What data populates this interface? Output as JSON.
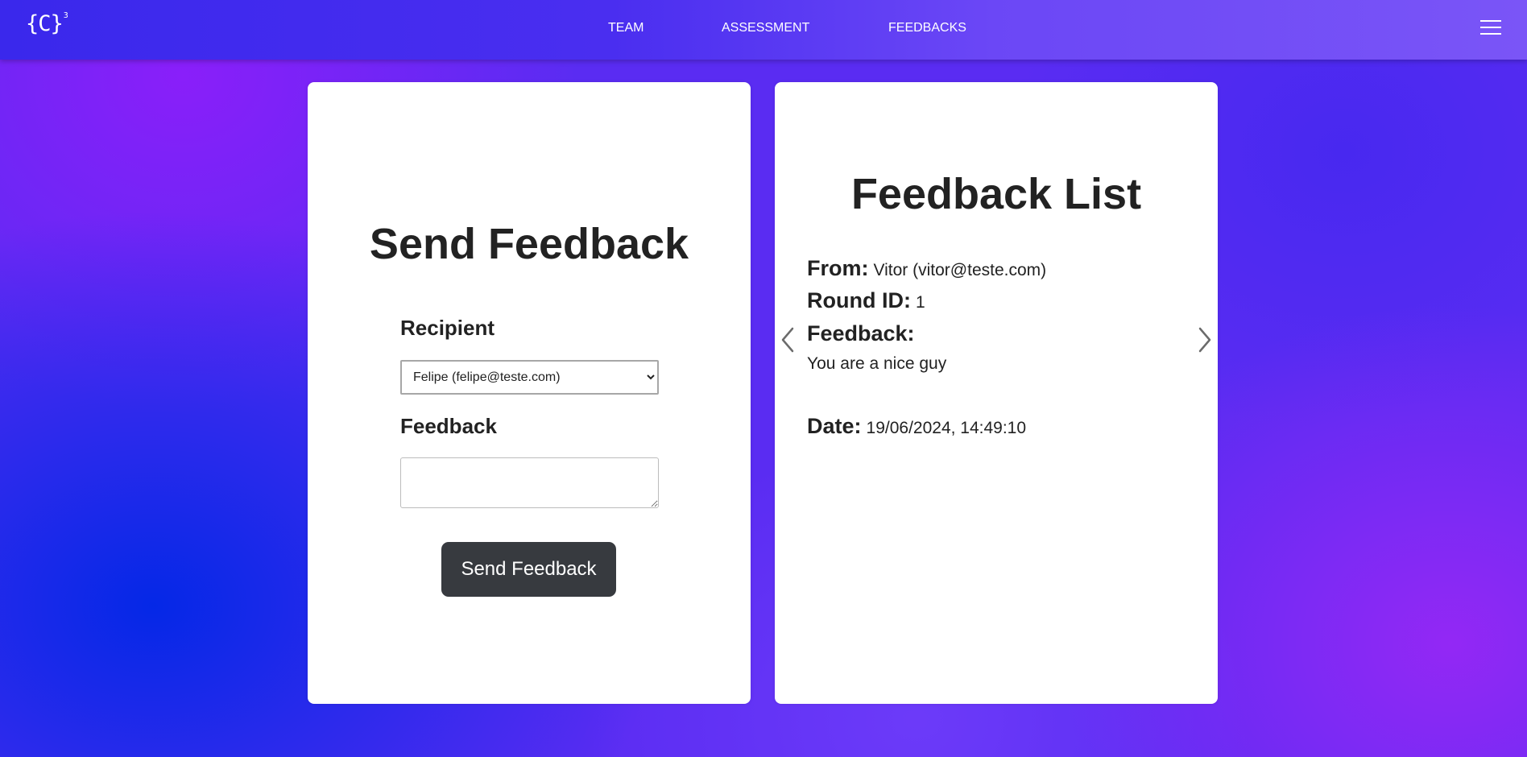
{
  "nav": {
    "logo": "{C}",
    "logo_sup": "3",
    "links": [
      "TEAM",
      "ASSESSMENT",
      "FEEDBACKS"
    ],
    "menu_icon": "hamburger-icon"
  },
  "send": {
    "title": "Send Feedback",
    "recipient_label": "Recipient",
    "recipient_selected": "Felipe (felipe@teste.com)",
    "feedback_label": "Feedback",
    "feedback_value": "",
    "button_label": "Send Feedback"
  },
  "list": {
    "title": "Feedback List",
    "from_label": "From:",
    "from_value": "Vitor (vitor@teste.com)",
    "round_label": "Round ID:",
    "round_value": "1",
    "feedback_label": "Feedback:",
    "feedback_value": "You are a nice guy",
    "date_label": "Date:",
    "date_value": "19/06/2024, 14:49:10",
    "prev_icon": "chevron-left-icon",
    "next_icon": "chevron-right-icon"
  },
  "colors": {
    "card_bg": "#ffffff",
    "button_bg": "#373a3f",
    "text": "#222222",
    "nav_start": "#3a28ec",
    "nav_end": "#7a55f7"
  }
}
